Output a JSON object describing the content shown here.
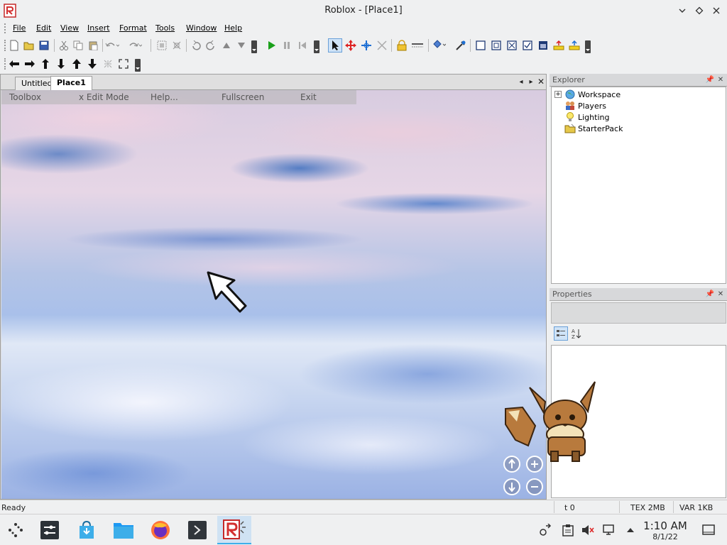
{
  "window": {
    "title": "Roblox - [Place1]",
    "app_icon": "roblox-logo-icon",
    "controls": [
      "minimize-icon",
      "maximize-icon",
      "close-icon"
    ]
  },
  "menubar": {
    "items": [
      "File",
      "Edit",
      "View",
      "Insert",
      "Format",
      "Tools",
      "Window",
      "Help"
    ]
  },
  "toolbars": {
    "row1": [
      "new-icon",
      "open-icon",
      "save-icon",
      "cut-icon",
      "copy-icon",
      "paste-icon",
      "undo-icon",
      "redo-icon",
      "group-icon",
      "ungroup-icon",
      "rotate-left-icon",
      "rotate-right-icon",
      "move-up-icon",
      "move-down-icon",
      "play-icon",
      "pause-icon",
      "stop-icon",
      "select-icon",
      "move-icon",
      "axis-move-icon",
      "resize-icon",
      "lock-icon",
      "anchor-icon",
      "paint-bucket-icon",
      "dropper-icon",
      "part-icon",
      "surface-icon",
      "weld-icon",
      "glue-icon",
      "hinge-icon",
      "motor-icon",
      "smooth-icon"
    ],
    "row2": [
      "left-arrow-icon",
      "right-arrow-icon",
      "up-arrow-icon",
      "down-arrow-icon",
      "tilt-up-icon",
      "tilt-down-icon",
      "zoom-extents-icon",
      "fit-icon"
    ]
  },
  "document": {
    "tabs": [
      {
        "label": "Untitled",
        "active": false
      },
      {
        "label": "Place1",
        "active": true
      }
    ],
    "viewport_menu": [
      "Toolbox",
      "x Edit Mode",
      "Help...",
      "Fullscreen",
      "Exit"
    ]
  },
  "explorer": {
    "title": "Explorer",
    "items": [
      {
        "label": "Workspace",
        "icon": "globe-icon",
        "expandable": true
      },
      {
        "label": "Players",
        "icon": "players-icon",
        "expandable": false
      },
      {
        "label": "Lighting",
        "icon": "lightbulb-icon",
        "expandable": false
      },
      {
        "label": "StarterPack",
        "icon": "folder-icon",
        "expandable": false
      }
    ]
  },
  "properties": {
    "title": "Properties",
    "tools": [
      "categorized-icon",
      "sort-alpha-icon"
    ]
  },
  "statusbar": {
    "left": "Ready",
    "t": "t 0",
    "tex": "TEX 2MB",
    "var": "VAR 1KB"
  },
  "taskbar": {
    "apps": [
      "launcher-icon",
      "settings-icon",
      "store-icon",
      "files-icon",
      "firefox-icon",
      "terminal-icon",
      "roblox-icon"
    ],
    "tray": [
      "network-sync-icon",
      "clipboard-icon",
      "muted-volume-icon",
      "display-icon",
      "tray-expand-icon",
      "show-desktop-icon"
    ],
    "time": "1:10 AM",
    "date": "8/1/22"
  }
}
